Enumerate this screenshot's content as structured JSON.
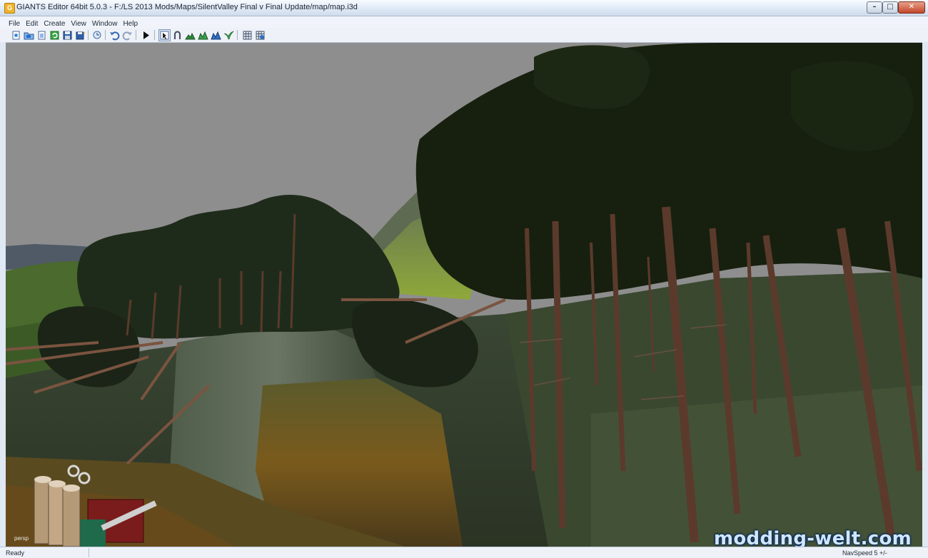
{
  "app": {
    "title": "GIANTS Editor 64bit 5.0.3 - F:/LS 2013 Mods/Maps/SilentValley Final v Final Update/map/map.i3d",
    "icon": "giants-app-icon",
    "icon_letter": "G"
  },
  "window_controls": {
    "minimize": "–",
    "maximize": "□",
    "close": "✕"
  },
  "menu": [
    {
      "label": "File"
    },
    {
      "label": "Edit"
    },
    {
      "label": "Create"
    },
    {
      "label": "View"
    },
    {
      "label": "Window"
    },
    {
      "label": "Help"
    }
  ],
  "toolbar": {
    "items": [
      {
        "name": "new-scene-icon"
      },
      {
        "name": "open-file-icon"
      },
      {
        "name": "import-icon"
      },
      {
        "name": "reload-icon"
      },
      {
        "name": "save-icon"
      },
      {
        "name": "save-all-icon"
      },
      {
        "name": "open-recent-icon"
      },
      {
        "name": "undo-icon"
      },
      {
        "name": "redo-icon"
      },
      {
        "name": "play-icon"
      },
      {
        "name": "select-mode-icon"
      },
      {
        "name": "move-mode-icon"
      },
      {
        "name": "terrain-sculpt-icon"
      },
      {
        "name": "terrain-paint-icon"
      },
      {
        "name": "foliage-paint-icon"
      },
      {
        "name": "plant-paint-icon"
      },
      {
        "name": "grid-icon"
      },
      {
        "name": "snap-icon"
      }
    ]
  },
  "viewport": {
    "camera_label": "persp",
    "watermark": "modding-welt.com"
  },
  "status": {
    "left": "Ready",
    "right": "NavSpeed 5 +/-"
  },
  "colors": {
    "sky": "#8e8e8e",
    "titlebar": "#dde8f5",
    "watermark": "#cfe6ff"
  }
}
